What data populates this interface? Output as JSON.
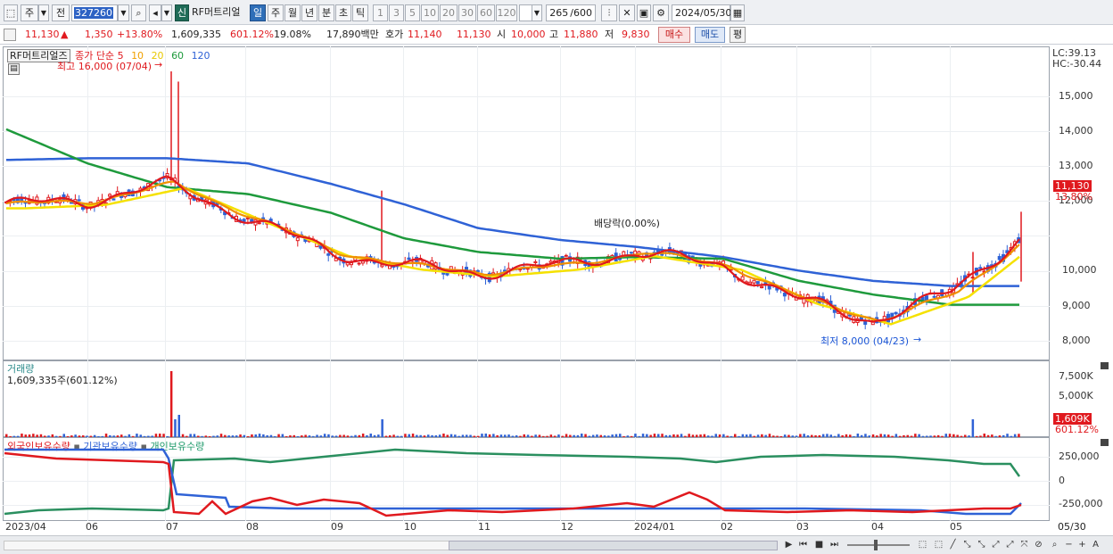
{
  "toolbar": {
    "period_toggle": "주",
    "prev_label": "전",
    "code": "327260",
    "new_badge": "신",
    "stock_name": "RF머트리얼",
    "periods": [
      "일",
      "주",
      "월",
      "년",
      "분",
      "초",
      "틱"
    ],
    "active_period": "일",
    "intervals": [
      "1",
      "3",
      "5",
      "10",
      "20",
      "30",
      "60",
      "120"
    ],
    "count": "265",
    "count_total": "/600",
    "date": "2024/05/30"
  },
  "info": {
    "price": "11,130",
    "arrow": "▲",
    "change": "1,350",
    "change_pct": "+13.80%",
    "volume": "1,609,335",
    "vol_ratio": "601.12%",
    "turnover": "19.08%",
    "amount": "17,890백만",
    "quote_label": "호가",
    "ask": "11,140",
    "bid": "11,130",
    "open_label": "시",
    "open": "10,000",
    "high_label": "고",
    "high": "11,880",
    "low_label": "저",
    "low": "9,830",
    "buy": "매수",
    "sell": "매도",
    "eval": "평"
  },
  "price_panel": {
    "title": "RF머트리얼즈",
    "ma_label": "종가 단순",
    "ma_periods": [
      "5",
      "10",
      "20",
      "60",
      "120"
    ],
    "ma_colors": [
      "#e0191e",
      "#f0a000",
      "#e8d800",
      "#1e9a3c",
      "#2f62d6"
    ],
    "high_note": "최고 16,000 (07/04)",
    "low_note": "최저 8,000 (04/23)",
    "dividend_note": "배당락(0.00%)",
    "lc": "LC:39.13",
    "hc": "HC:-30.44",
    "y_ticks": [
      "15,000",
      "14,000",
      "13,000",
      "12,000",
      "11,000",
      "10,000",
      "9,000",
      "8,000"
    ],
    "current_tag": "11,130",
    "current_pct": "13.80%"
  },
  "volume_panel": {
    "title": "거래량",
    "value": "1,609,335주(601.12%)",
    "y_ticks": [
      "7,500K",
      "5,000K",
      "2,500K"
    ],
    "current_tag": "1,609K",
    "current_pct": "601.12%"
  },
  "holding_panel": {
    "labels": [
      "외국인보유수량",
      "기관보유수량",
      "개인보유수량"
    ],
    "colors": [
      "#e0191e",
      "#2f62d6",
      "#1e9a6a"
    ],
    "y_ticks": [
      "250,000",
      "0",
      "-250,000"
    ]
  },
  "x_axis": [
    "2023/04",
    "06",
    "07",
    "08",
    "09",
    "10",
    "11",
    "12",
    "2024/01",
    "02",
    "03",
    "04",
    "05",
    "05/30"
  ],
  "chart_data": {
    "type": "line",
    "title": "RF머트리얼즈",
    "x": [
      "2023/04",
      "06",
      "07",
      "08",
      "09",
      "10",
      "11",
      "12",
      "2024/01",
      "02",
      "03",
      "04",
      "05",
      "05/30"
    ],
    "series": [
      {
        "name": "5",
        "values": [
          12100,
          12200,
          12700,
          11700,
          10700,
          10300,
          10100,
          10300,
          10700,
          10300,
          9300,
          8700,
          9500,
          11130
        ]
      },
      {
        "name": "120",
        "values": [
          13400,
          13450,
          13450,
          13300,
          12700,
          12100,
          11400,
          11050,
          10850,
          10550,
          10150,
          9850,
          9700,
          9700
        ]
      },
      {
        "name": "60",
        "values": [
          14300,
          13300,
          12600,
          12400,
          11850,
          11100,
          10700,
          10500,
          10550,
          10500,
          9850,
          9450,
          9150,
          9150
        ]
      }
    ],
    "ylim": [
      7700,
      16000
    ]
  }
}
